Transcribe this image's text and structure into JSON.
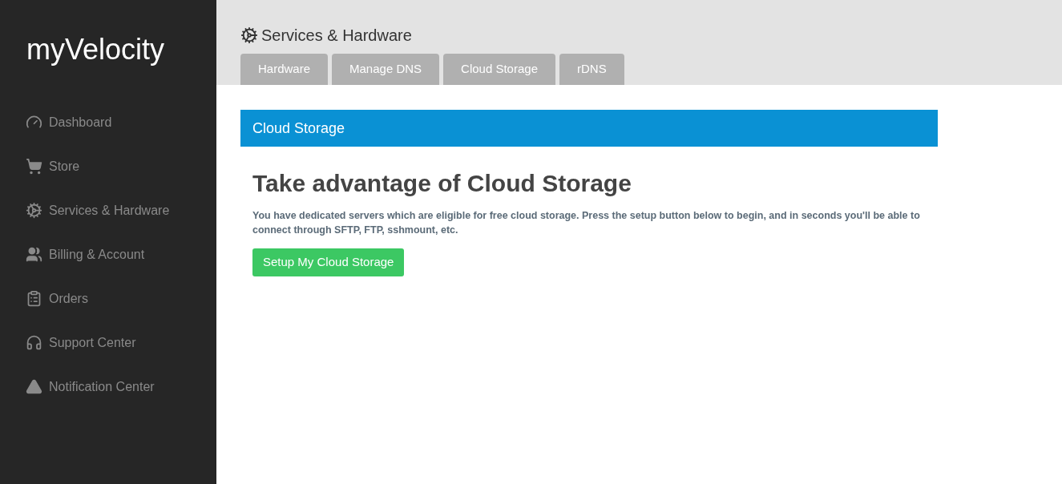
{
  "logo": "myVelocity",
  "sidebar": {
    "items": [
      {
        "label": "Dashboard",
        "selected": false
      },
      {
        "label": "Store",
        "selected": false
      },
      {
        "label": "Services & Hardware",
        "selected": false
      },
      {
        "label": "Billing & Account",
        "selected": false
      },
      {
        "label": "Orders",
        "selected": false
      },
      {
        "label": "Support Center",
        "selected": false
      },
      {
        "label": "Notification Center",
        "selected": false
      }
    ]
  },
  "page_title": "Services & Hardware",
  "tabs": [
    {
      "label": "Hardware",
      "selected": false
    },
    {
      "label": "Manage DNS",
      "selected": false
    },
    {
      "label": "Cloud Storage",
      "selected": false
    },
    {
      "label": "rDNS",
      "selected": false
    }
  ],
  "panel": {
    "title": "Cloud Storage",
    "heading": "Take advantage of Cloud Storage",
    "text": "You have dedicated servers which are eligible for free cloud storage. Press the setup button below to begin, and in seconds you'll be able to connect through SFTP, FTP, sshmount, etc.",
    "button": "Setup My Cloud Storage"
  }
}
